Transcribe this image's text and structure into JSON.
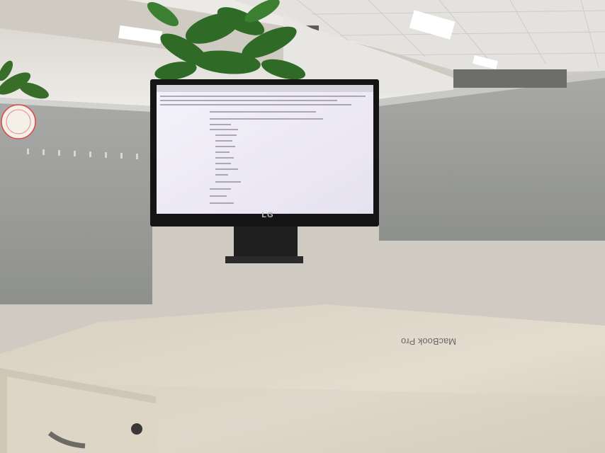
{
  "scene": {
    "monitor_brand": "LG",
    "box_label": "MacBook Pro",
    "colors": {
      "wall": "#e6e4df",
      "ceiling": "#ebe9e6",
      "partition": "#a3a4a2",
      "desk": "#e0d9cc",
      "bear": "#d38e3e",
      "hat": "#c0202a",
      "plant": "#2f6b26"
    }
  }
}
